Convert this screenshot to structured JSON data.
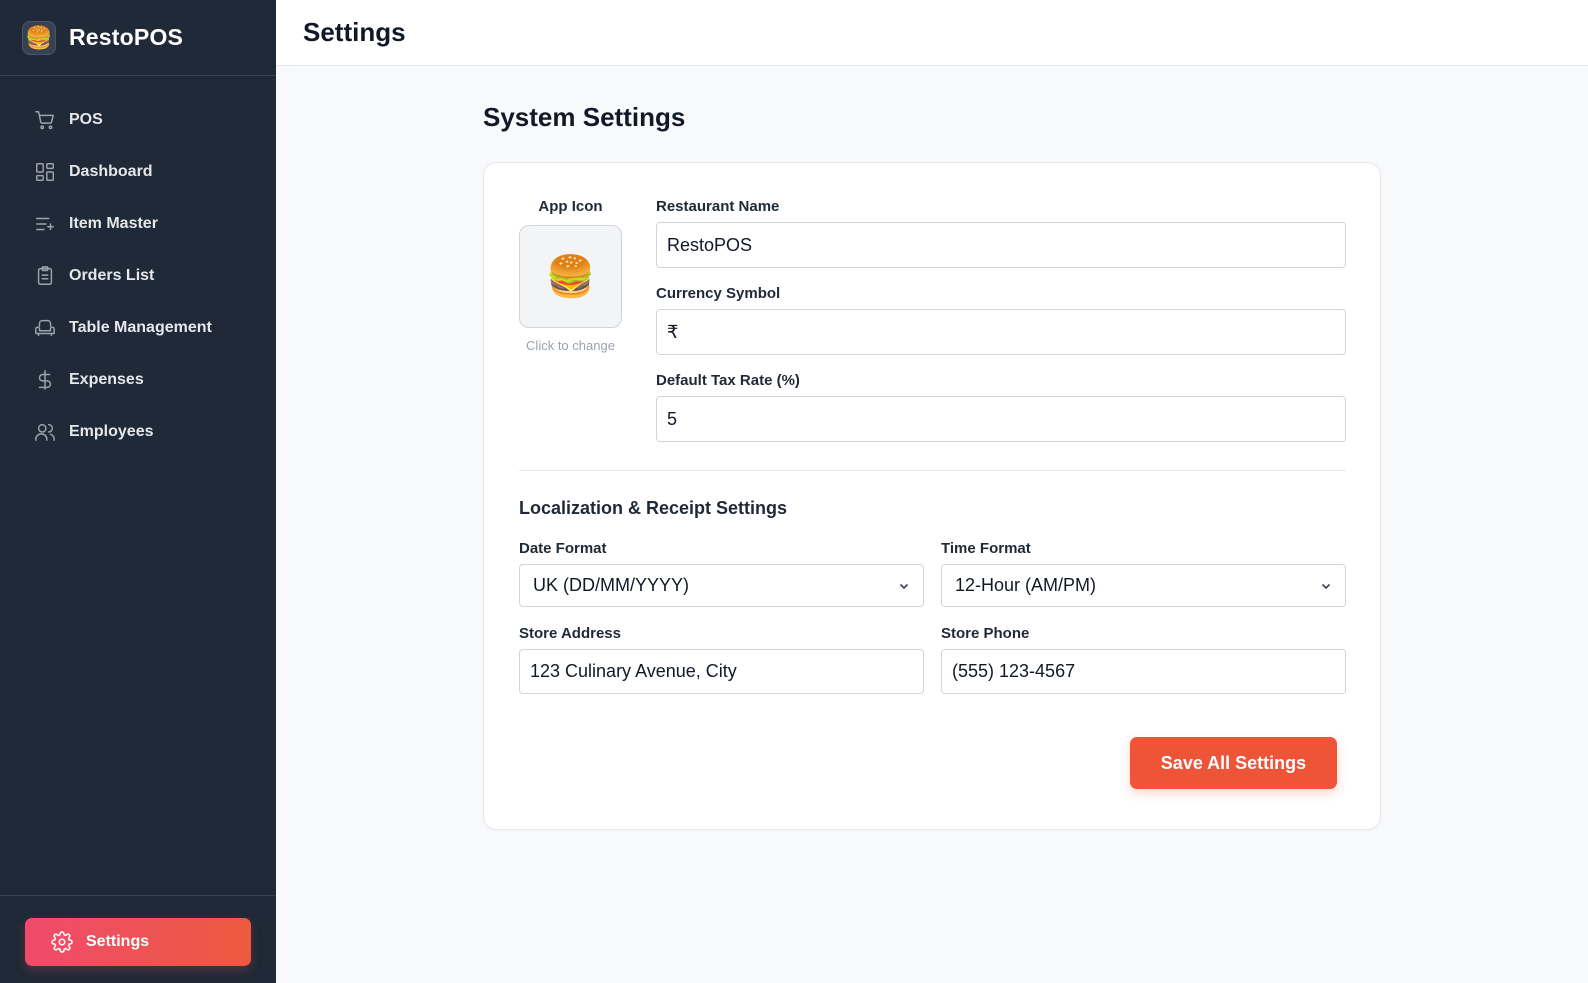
{
  "app": {
    "name": "RestoPOS",
    "logo_emoji": "🍔"
  },
  "sidebar": {
    "items": [
      {
        "label": "POS",
        "icon": "cart-icon"
      },
      {
        "label": "Dashboard",
        "icon": "dashboard-grid-icon"
      },
      {
        "label": "Item Master",
        "icon": "list-add-icon"
      },
      {
        "label": "Orders List",
        "icon": "clipboard-icon"
      },
      {
        "label": "Table Management",
        "icon": "armchair-icon"
      },
      {
        "label": "Expenses",
        "icon": "dollar-icon"
      },
      {
        "label": "Employees",
        "icon": "users-icon"
      }
    ],
    "footer_item": {
      "label": "Settings",
      "icon": "gear-icon",
      "active": true
    }
  },
  "header": {
    "title": "Settings"
  },
  "main": {
    "section_title": "System Settings",
    "app_icon": {
      "label": "App Icon",
      "emoji": "🍔",
      "hint": "Click to change"
    },
    "restaurant_name": {
      "label": "Restaurant Name",
      "value": "RestoPOS"
    },
    "currency_symbol": {
      "label": "Currency Symbol",
      "value": "₹"
    },
    "tax_rate": {
      "label": "Default Tax Rate (%)",
      "value": "5"
    },
    "localization": {
      "title": "Localization & Receipt Settings",
      "date_format": {
        "label": "Date Format",
        "value": "UK (DD/MM/YYYY)"
      },
      "time_format": {
        "label": "Time Format",
        "value": "12-Hour (AM/PM)"
      },
      "store_address": {
        "label": "Store Address",
        "value": "123 Culinary Avenue, City"
      },
      "store_phone": {
        "label": "Store Phone",
        "value": "(555) 123-4567"
      }
    },
    "save_label": "Save All Settings"
  },
  "colors": {
    "sidebar_bg": "#1f2937",
    "accent": "#ed5438",
    "accent_gradient_start": "#ef4b6c"
  }
}
